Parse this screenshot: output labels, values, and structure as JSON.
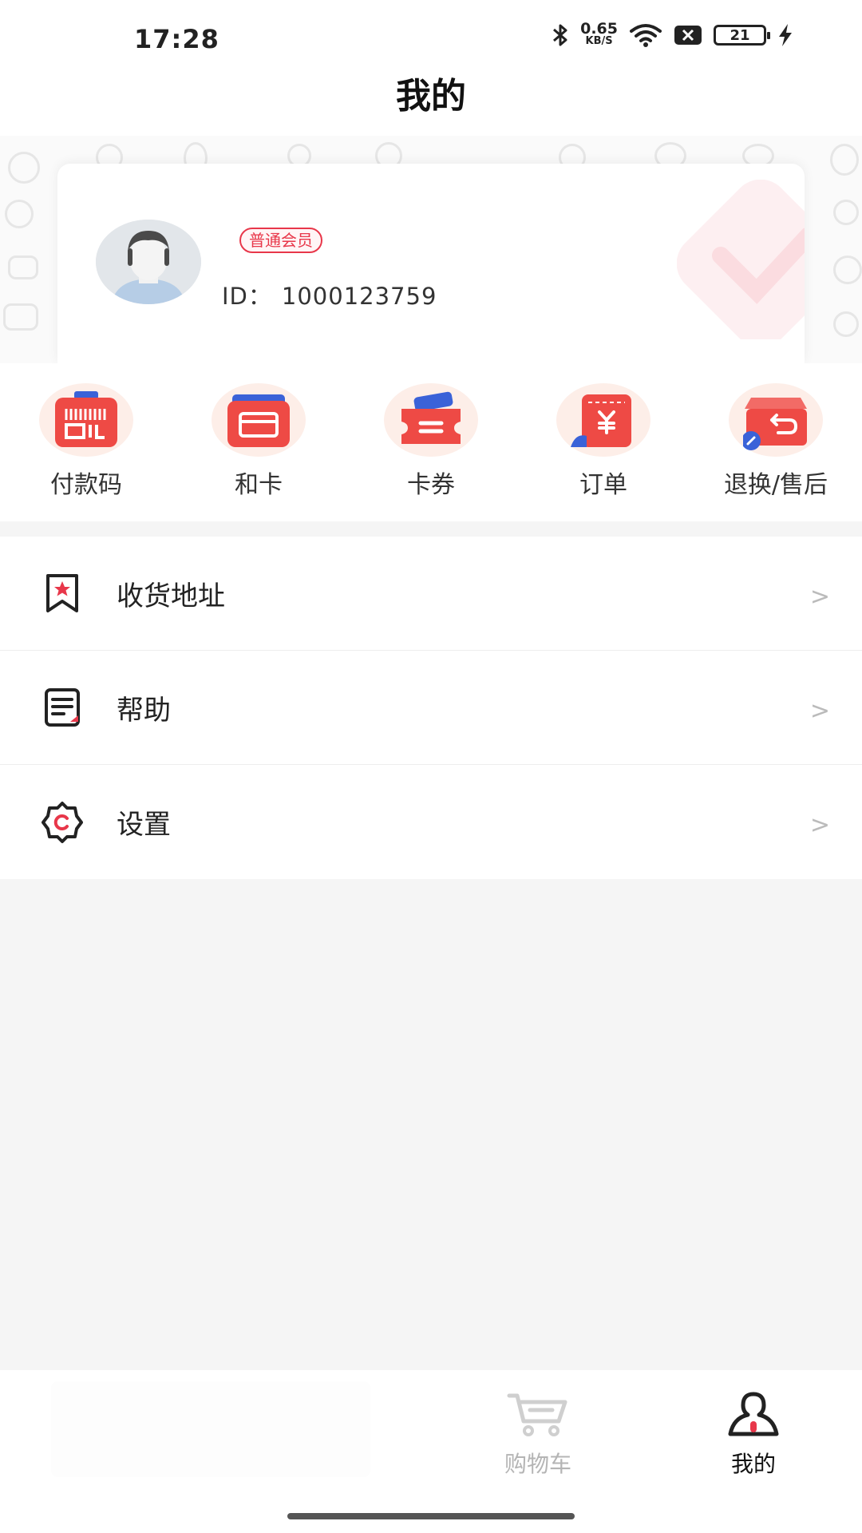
{
  "status_bar": {
    "time": "17:28",
    "net_speed_value": "0.65",
    "net_speed_unit": "KB/S",
    "battery_level": "21",
    "icons": [
      "bluetooth-icon",
      "wifi-icon",
      "sim-off-icon",
      "battery-icon",
      "charging-icon"
    ]
  },
  "header": {
    "title": "我的"
  },
  "profile": {
    "member_level": "普通会员",
    "id_label": "ID：",
    "id_value": "1000123759"
  },
  "quick_actions": [
    {
      "label": "付款码",
      "icon": "payment-code-icon"
    },
    {
      "label": "和卡",
      "icon": "card-icon"
    },
    {
      "label": "卡券",
      "icon": "coupon-icon"
    },
    {
      "label": "订单",
      "icon": "order-icon"
    },
    {
      "label": "退换/售后",
      "icon": "return-icon"
    }
  ],
  "menu": [
    {
      "label": "收货地址",
      "icon": "address-bookmark-icon"
    },
    {
      "label": "帮助",
      "icon": "help-document-icon"
    },
    {
      "label": "设置",
      "icon": "settings-gear-icon"
    }
  ],
  "bottom_nav": [
    {
      "label": "购物车",
      "icon": "cart-icon",
      "active": false
    },
    {
      "label": "我的",
      "icon": "profile-icon",
      "active": true
    }
  ],
  "colors": {
    "accent": "#e8374a",
    "page_background": "#f5f5f5",
    "inactive_text": "#b5b5b5"
  }
}
